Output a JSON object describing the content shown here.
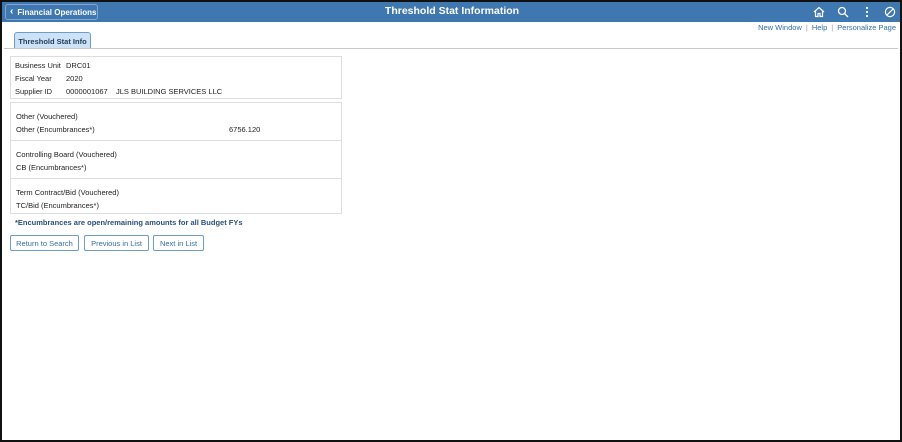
{
  "header": {
    "back_label": "Financial Operations",
    "title": "Threshold Stat Information",
    "icons": [
      "home-icon",
      "search-icon",
      "more-options-icon",
      "navbar-icon"
    ]
  },
  "links": {
    "new_window": "New Window",
    "help": "Help",
    "personalize": "Personalize Page",
    "separator": "|"
  },
  "tab": {
    "label": "Threshold Stat Info"
  },
  "key_fields": {
    "business_unit_label": "Business Unit",
    "business_unit_value": "DRC01",
    "fiscal_year_label": "Fiscal Year",
    "fiscal_year_value": "2020",
    "supplier_id_label": "Supplier ID",
    "supplier_id_value": "0000001067",
    "supplier_name": "JLS BUILDING SERVICES LLC"
  },
  "stats": {
    "other_vouchered_label": "Other (Vouchered)",
    "other_encumbrances_label": "Other (Encumbrances*)",
    "other_encumbrances_value": "6756.120",
    "cb_vouchered_label": "Controlling Board (Vouchered)",
    "cb_encumbrances_label": "CB (Encumbrances*)",
    "tc_vouchered_label": "Term Contract/Bid (Vouchered)",
    "tc_encumbrances_label": "TC/Bid (Encumbrances*)"
  },
  "note": "*Encumbrances are open/remaining amounts for all Budget FYs",
  "buttons": {
    "return": "Return to Search",
    "previous": "Previous in List",
    "next": "Next in List"
  },
  "colors": {
    "header_bg": "#3f77b0",
    "tab_bg": "#cde2f5",
    "link": "#356ea8"
  }
}
